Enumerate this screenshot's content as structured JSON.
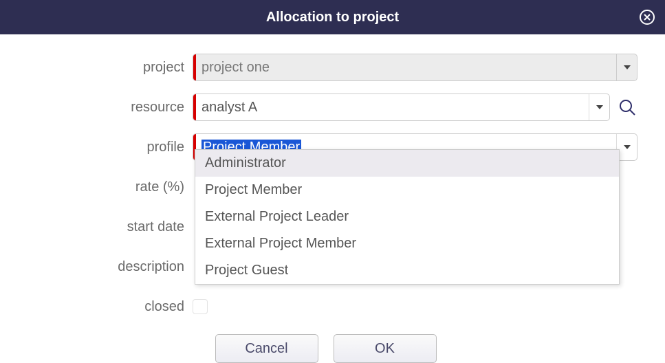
{
  "header": {
    "title": "Allocation to project"
  },
  "labels": {
    "project": "project",
    "resource": "resource",
    "profile": "profile",
    "rate": "rate (%)",
    "start_date": "start date",
    "description": "description",
    "closed": "closed"
  },
  "fields": {
    "project": {
      "value": "project one"
    },
    "resource": {
      "value": "analyst A"
    },
    "profile": {
      "value": "Project Member"
    }
  },
  "profile_options": [
    "Administrator",
    "Project Member",
    "External Project Leader",
    "External Project Member",
    "Project Guest"
  ],
  "buttons": {
    "cancel": "Cancel",
    "ok": "OK"
  }
}
